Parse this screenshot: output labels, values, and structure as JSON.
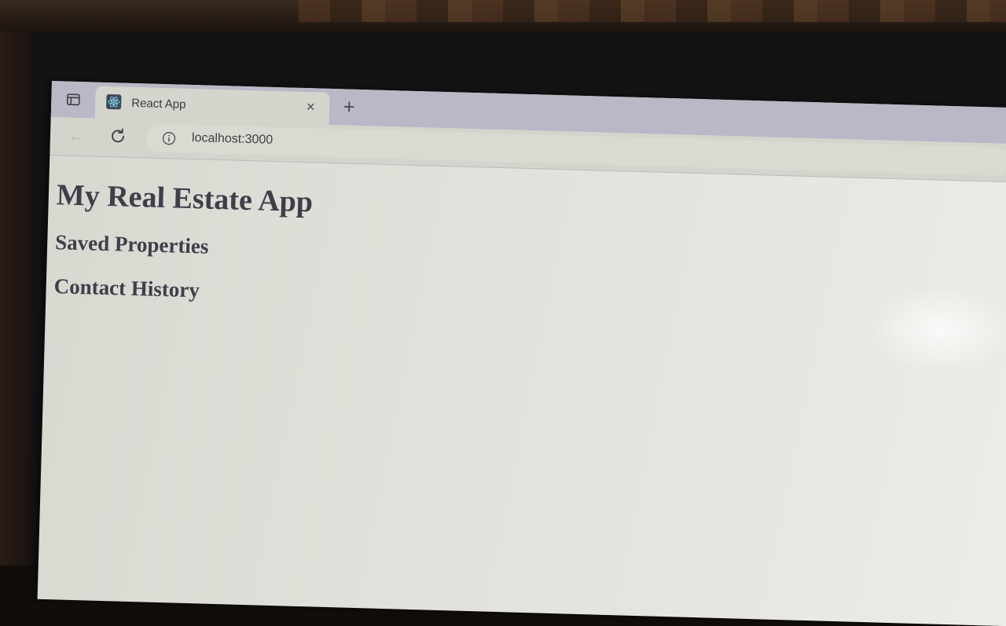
{
  "browser": {
    "tab": {
      "title": "React App",
      "close_label": "×",
      "favicon": "react-logo-icon"
    },
    "new_tab_label": "+",
    "address_bar": {
      "url": "localhost:3000"
    },
    "icons": {
      "sidebar": "sidebar-toggle-icon",
      "back": "back-arrow-icon",
      "reload": "reload-icon",
      "info": "info-icon"
    }
  },
  "page": {
    "title": "My Real Estate App",
    "sections": [
      {
        "heading": "Saved Properties"
      },
      {
        "heading": "Contact History"
      }
    ]
  },
  "colors": {
    "tab_strip": "#b8b8c6",
    "active_tab": "#d4d5cc",
    "page_background": "#e2e3dc",
    "heading_text": "#3e3f4a"
  }
}
